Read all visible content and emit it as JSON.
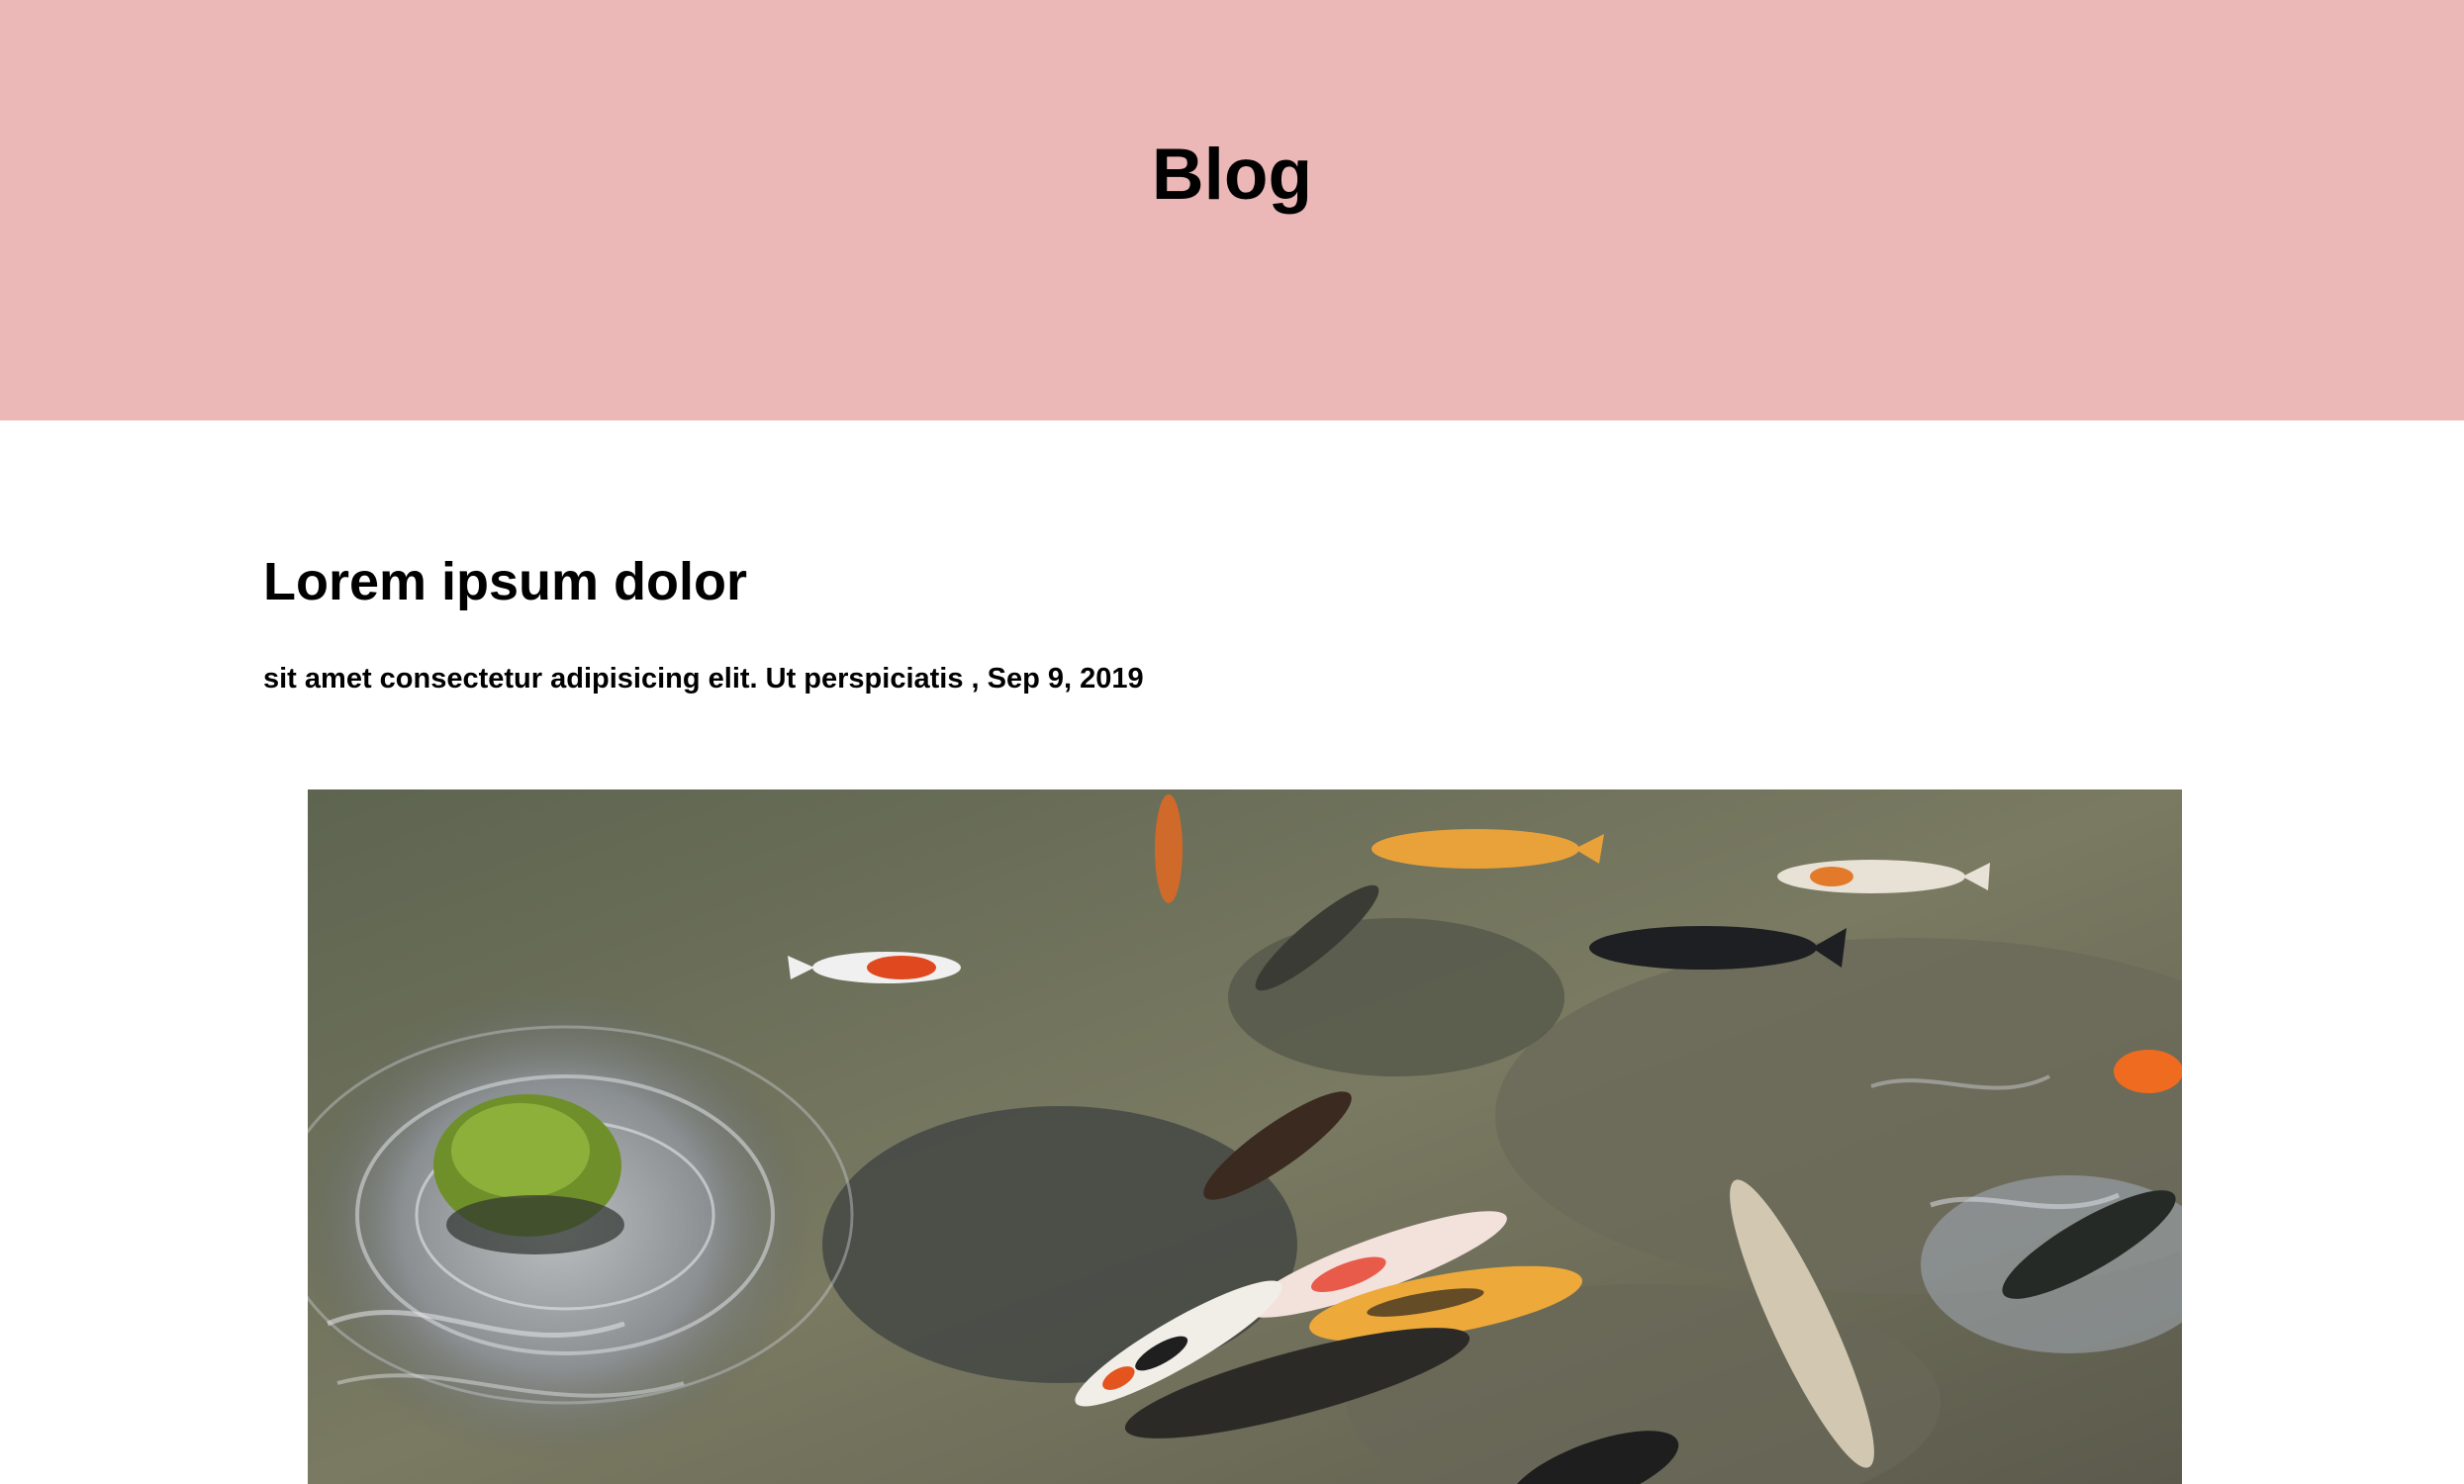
{
  "header": {
    "title": "Blog",
    "background_color": "#ecb8b7"
  },
  "post": {
    "title": "Lorem ipsum dolor",
    "subtitle": "sit amet consectetur adipisicing elit. Ut perspiciatis",
    "date": "Sep 9, 2019",
    "image_icon": "koi-pond-photo"
  }
}
